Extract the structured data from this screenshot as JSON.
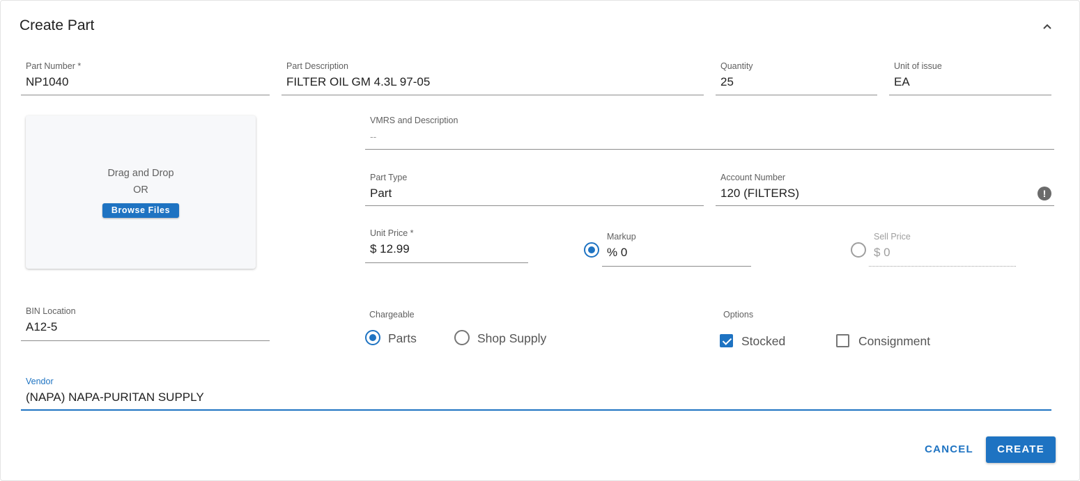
{
  "header": {
    "title": "Create Part",
    "collapse_icon": "chevron-up-icon"
  },
  "form": {
    "part_number": {
      "label": "Part Number *",
      "value": "NP1040"
    },
    "part_description": {
      "label": "Part Description",
      "value": "FILTER OIL GM 4.3L 97-05"
    },
    "quantity": {
      "label": "Quantity",
      "value": "25"
    },
    "unit_of_issue": {
      "label": "Unit of issue",
      "value": "EA"
    },
    "vmrs": {
      "label": "VMRS and Description",
      "value": "--"
    },
    "part_type": {
      "label": "Part Type",
      "value": "Part"
    },
    "account_number": {
      "label": "Account Number",
      "value": "120 (FILTERS)",
      "icon": "alert-circle-icon",
      "icon_glyph": "!"
    },
    "unit_price": {
      "label": "Unit Price *",
      "value": "$ 12.99"
    },
    "markup": {
      "label": "Markup",
      "value": "% 0",
      "selected": true
    },
    "sell_price": {
      "label": "Sell Price",
      "value": "$ 0",
      "selected": false
    },
    "bin_location": {
      "label": "BIN Location",
      "value": "A12-5"
    },
    "vendor": {
      "label": "Vendor",
      "value": "(NAPA) NAPA-PURITAN SUPPLY"
    }
  },
  "dropzone": {
    "text": "Drag and Drop",
    "or_text": "OR",
    "browse_label": "Browse Files"
  },
  "chargeable": {
    "label": "Chargeable",
    "options": [
      {
        "label": "Parts",
        "selected": true
      },
      {
        "label": "Shop Supply",
        "selected": false
      }
    ]
  },
  "options": {
    "label": "Options",
    "items": [
      {
        "label": "Stocked",
        "checked": true
      },
      {
        "label": "Consignment",
        "checked": false
      }
    ]
  },
  "actions": {
    "cancel_label": "CANCEL",
    "create_label": "CREATE"
  },
  "colors": {
    "accent": "#1e73c2",
    "text": "#212121",
    "label": "#5f5f5f"
  }
}
